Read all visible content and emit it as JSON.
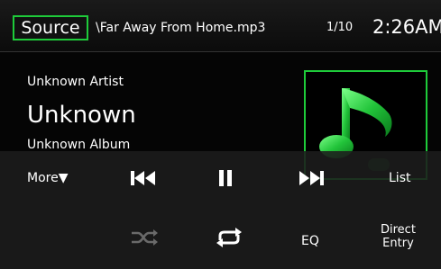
{
  "header": {
    "source_label": "Source",
    "track_file": "\\Far Away From Home.mp3",
    "track_index": "1/10",
    "clock": "2:26AM"
  },
  "info": {
    "artist": "Unknown Artist",
    "title": "Unknown",
    "album": "Unknown Album"
  },
  "controls": {
    "more_label": "More▼",
    "list_label": "List",
    "eq_label": "EQ",
    "direct_entry_line1": "Direct",
    "direct_entry_line2": "Entry",
    "icons": [
      "previous-track-icon",
      "pause-icon",
      "next-track-icon",
      "shuffle-icon",
      "repeat-icon"
    ]
  },
  "colors": {
    "accent": "#1ecb3a",
    "background": "#050505",
    "panel": "#1c1c1c",
    "text": "#ffffff",
    "shuffle_disabled": "#6a6a6a"
  }
}
